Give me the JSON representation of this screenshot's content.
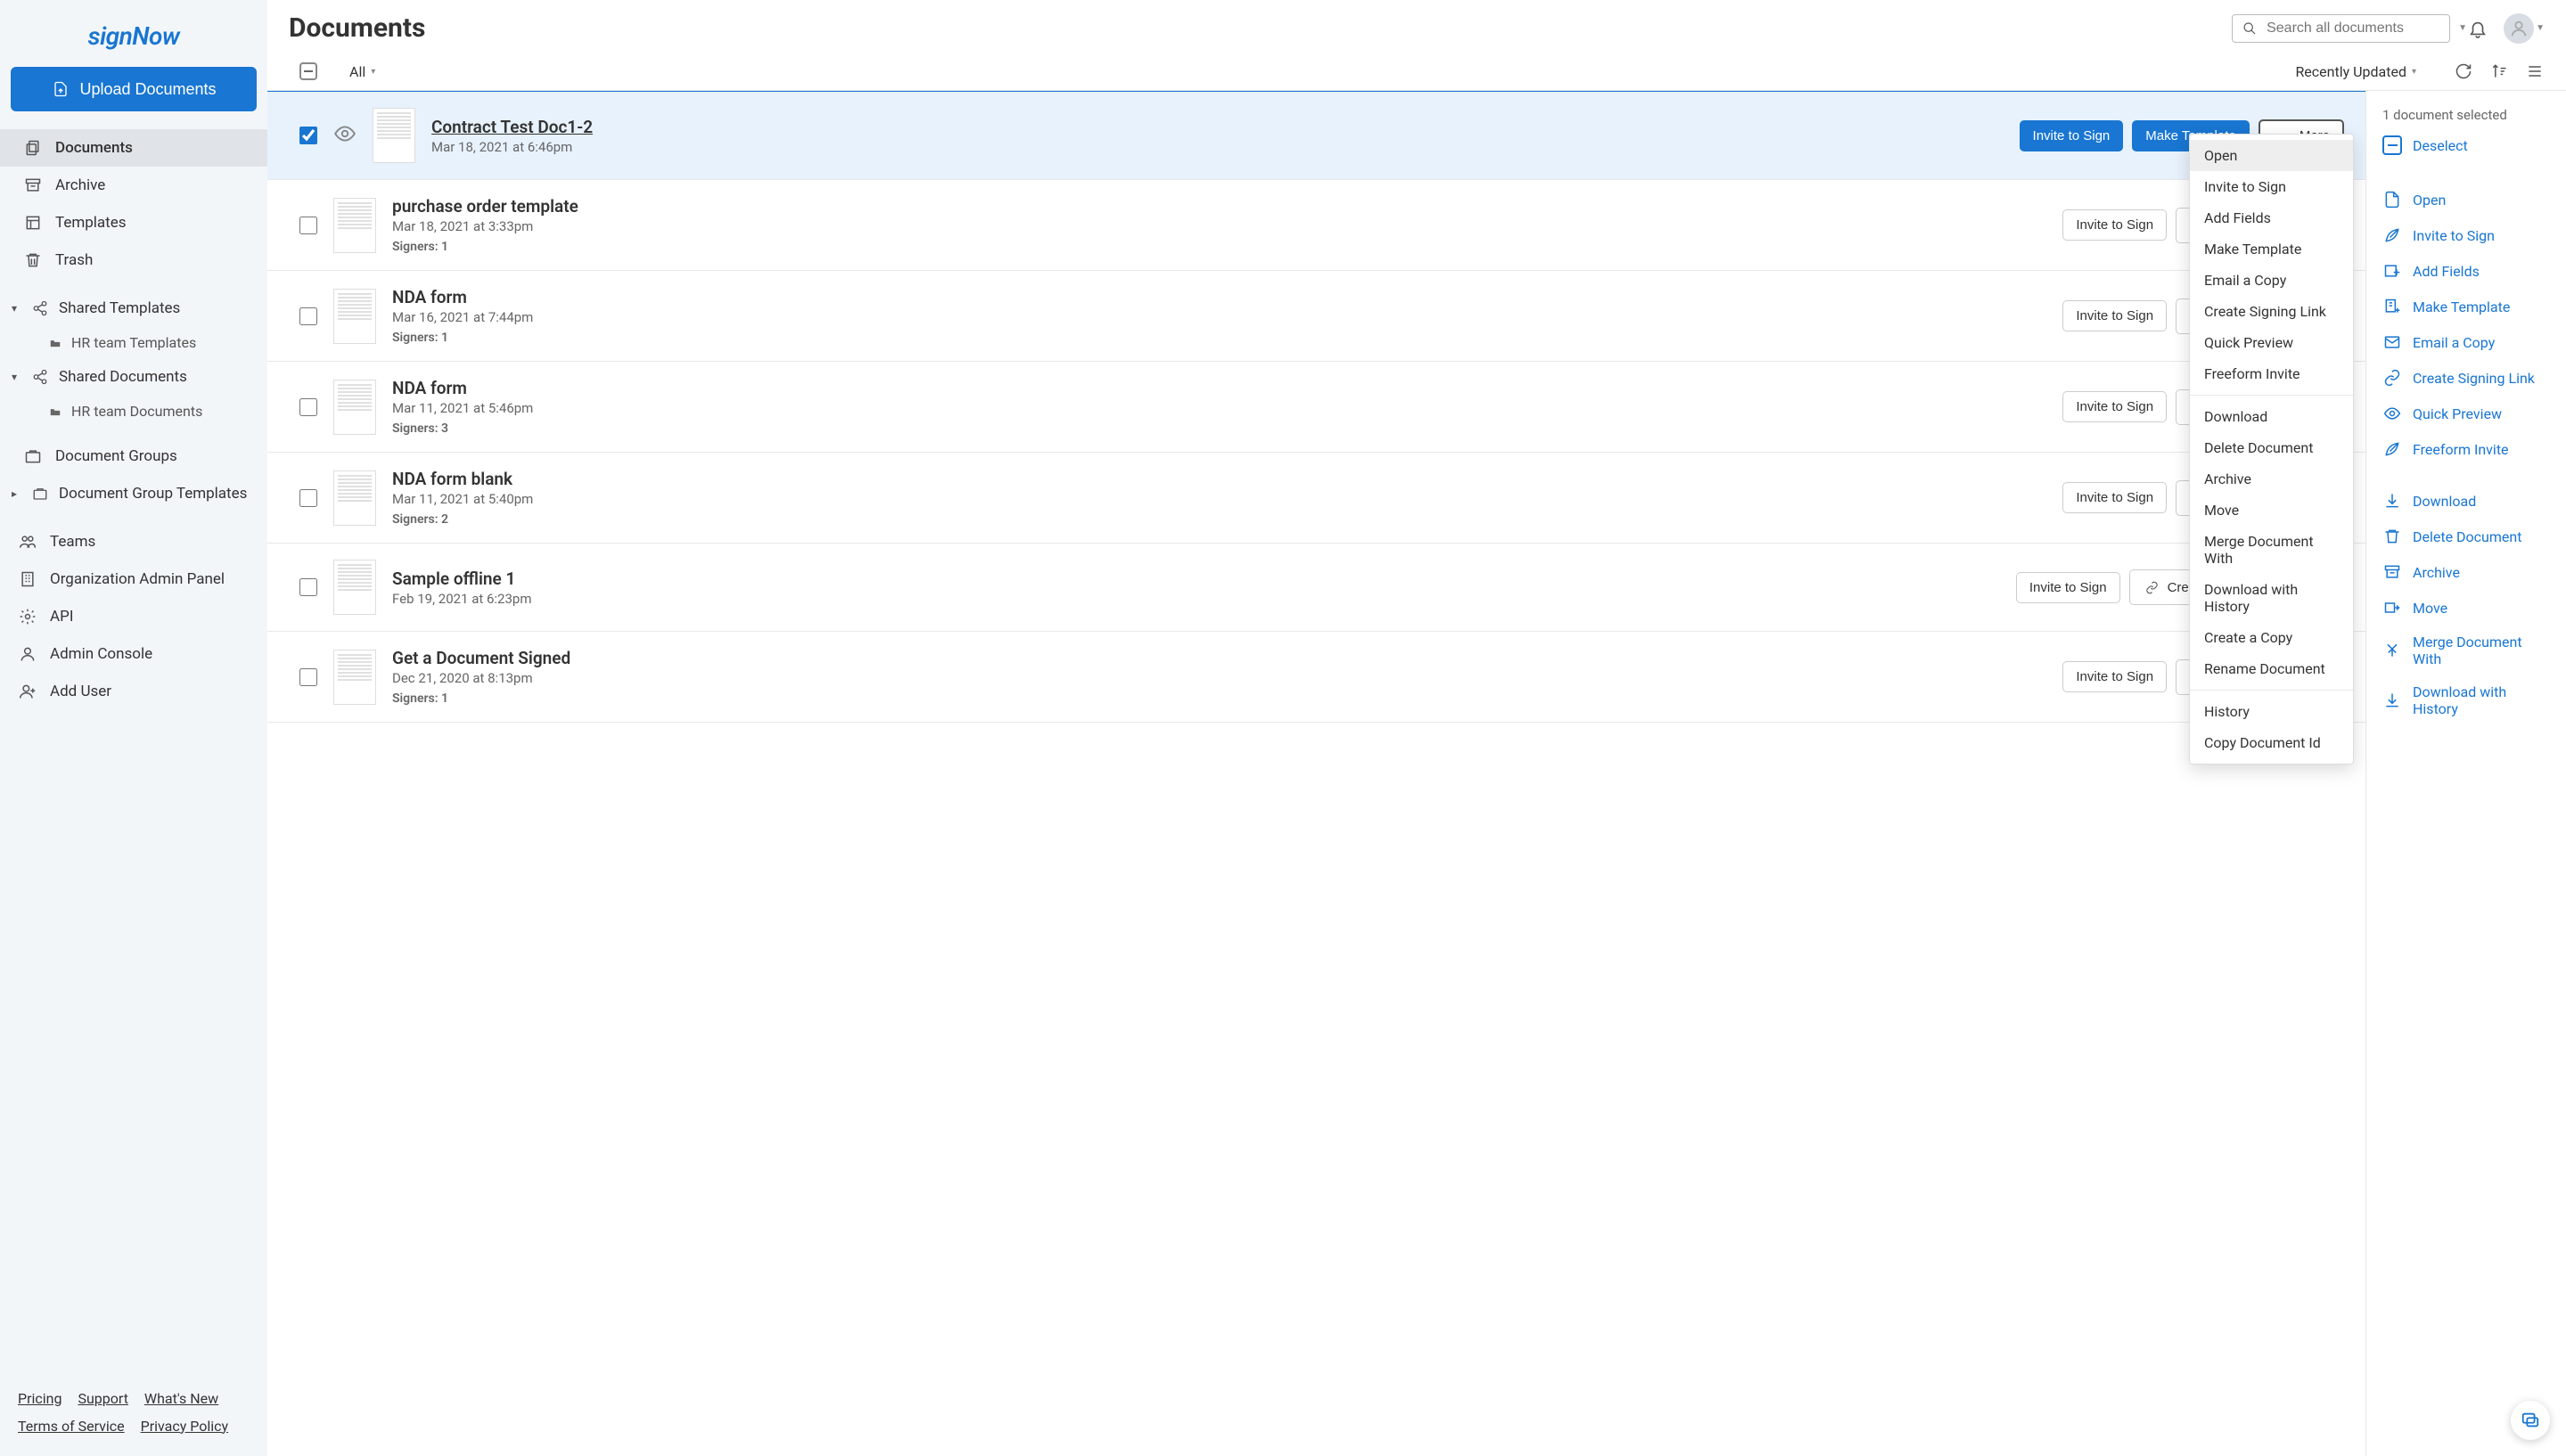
{
  "brand": "signNow",
  "upload_label": "Upload Documents",
  "nav": {
    "documents": "Documents",
    "archive": "Archive",
    "templates": "Templates",
    "trash": "Trash",
    "shared_templates": "Shared Templates",
    "hr_templates": "HR team Templates",
    "shared_documents": "Shared Documents",
    "hr_documents": "HR team Documents",
    "doc_groups": "Document Groups",
    "doc_group_templates": "Document Group Templates",
    "teams": "Teams",
    "org_admin": "Organization Admin Panel",
    "api": "API",
    "admin_console": "Admin Console",
    "add_user": "Add User"
  },
  "footer": {
    "pricing": "Pricing",
    "support": "Support",
    "whats_new": "What's New",
    "tos": "Terms of Service",
    "privacy": "Privacy Policy"
  },
  "page_title": "Documents",
  "search_placeholder": "Search all documents",
  "filter_all": "All",
  "sort_label": "Recently Updated",
  "buttons": {
    "invite": "Invite to Sign",
    "make_template": "Make Template",
    "more": "More",
    "create_link": "Create Signing Link"
  },
  "signers_label": "Signers:",
  "documents": [
    {
      "name": "Contract Test Doc1-2",
      "date": "Mar 18, 2021 at 6:46pm",
      "selected": true,
      "signers": null
    },
    {
      "name": "purchase order template",
      "date": "Mar 18, 2021 at 3:33pm",
      "selected": false,
      "signers": "1"
    },
    {
      "name": "NDA form",
      "date": "Mar 16, 2021 at 7:44pm",
      "selected": false,
      "signers": "1"
    },
    {
      "name": "NDA form",
      "date": "Mar 11, 2021 at 5:46pm",
      "selected": false,
      "signers": "3"
    },
    {
      "name": "NDA form blank",
      "date": "Mar 11, 2021 at 5:40pm",
      "selected": false,
      "signers": "2"
    },
    {
      "name": "Sample offline 1",
      "date": "Feb 19, 2021 at 6:23pm",
      "selected": false,
      "signers": null
    },
    {
      "name": "Get a Document Signed",
      "date": "Dec 21, 2020 at 8:13pm",
      "selected": false,
      "signers": "1"
    }
  ],
  "more_menu": {
    "open": "Open",
    "invite": "Invite to Sign",
    "add_fields": "Add Fields",
    "make_template": "Make Template",
    "email_copy": "Email a Copy",
    "signing_link": "Create Signing Link",
    "quick_preview": "Quick Preview",
    "freeform": "Freeform Invite",
    "download": "Download",
    "delete": "Delete Document",
    "archive": "Archive",
    "move": "Move",
    "merge": "Merge Document With",
    "download_history": "Download with History",
    "copy": "Create a Copy",
    "rename": "Rename Document",
    "history": "History",
    "copy_id": "Copy Document Id"
  },
  "right": {
    "selected_count": "1 document selected",
    "deselect": "Deselect",
    "open": "Open",
    "invite": "Invite to Sign",
    "add_fields": "Add Fields",
    "make_template": "Make Template",
    "email_copy": "Email a Copy",
    "signing_link": "Create Signing Link",
    "quick_preview": "Quick Preview",
    "freeform": "Freeform Invite",
    "download": "Download",
    "delete": "Delete Document",
    "archive": "Archive",
    "move": "Move",
    "merge": "Merge Document With",
    "download_history": "Download with History",
    "copy": "Create a Copy"
  }
}
